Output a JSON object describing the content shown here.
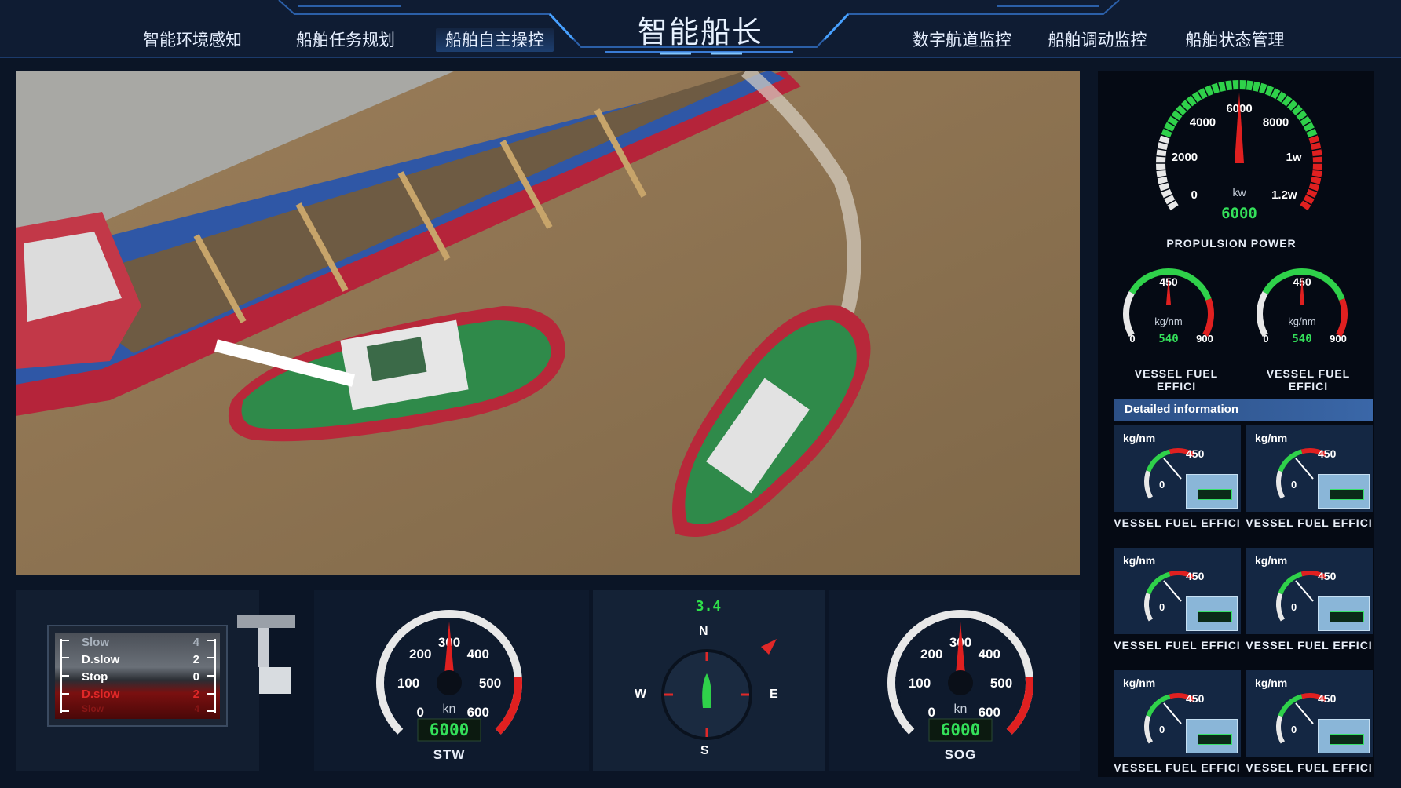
{
  "header": {
    "title": "智能船长",
    "nav_left": [
      "智能环境感知",
      "船舶任务规划",
      "船舶自主操控"
    ],
    "nav_right": [
      "数字航道监控",
      "船舶调动监控",
      "船舶状态管理"
    ],
    "active_nav": "船舶自主操控"
  },
  "propulsion": {
    "label": "PROPULSION POWER",
    "unit": "kw",
    "readout": "6000",
    "ticks": [
      "0",
      "2000",
      "4000",
      "6000",
      "8000",
      "1w",
      "1.2w"
    ]
  },
  "fuel_gauges": [
    {
      "label": "VESSEL FUEL EFFICI",
      "unit": "kg/nm",
      "max_label": "450",
      "min": "0",
      "max": "900",
      "readout": "540"
    },
    {
      "label": "VESSEL FUEL EFFICI",
      "unit": "kg/nm",
      "max_label": "450",
      "min": "0",
      "max": "900",
      "readout": "540"
    }
  ],
  "detail": {
    "header": "Detailed information",
    "cells": [
      {
        "unit": "kg/nm",
        "max": "450",
        "min": "0",
        "label": "VESSEL FUEL EFFICI"
      },
      {
        "unit": "kg/nm",
        "max": "450",
        "min": "0",
        "label": "VESSEL FUEL EFFICI"
      },
      {
        "unit": "kg/nm",
        "max": "450",
        "min": "0",
        "label": "VESSEL FUEL EFFICI"
      },
      {
        "unit": "kg/nm",
        "max": "450",
        "min": "0",
        "label": "VESSEL FUEL EFFICI"
      },
      {
        "unit": "kg/nm",
        "max": "450",
        "min": "0",
        "label": "VESSEL FUEL EFFICI"
      },
      {
        "unit": "kg/nm",
        "max": "450",
        "min": "0",
        "label": "VESSEL FUEL EFFICI"
      }
    ]
  },
  "telegraph": {
    "rows": [
      {
        "label": "Slow",
        "value": "4"
      },
      {
        "label": "D.slow",
        "value": "2"
      },
      {
        "label": "Stop",
        "value": "0"
      },
      {
        "label": "D.slow",
        "value": "2"
      },
      {
        "label": "Slow",
        "value": "4"
      }
    ]
  },
  "stw": {
    "label": "STW",
    "unit": "kn",
    "readout": "6000",
    "ticks": [
      "0",
      "100",
      "200",
      "300",
      "400",
      "500",
      "600"
    ]
  },
  "sog": {
    "label": "SOG",
    "unit": "kn",
    "readout": "6000",
    "ticks": [
      "0",
      "100",
      "200",
      "300",
      "400",
      "500",
      "600"
    ]
  },
  "compass": {
    "heading_readout": "3.4",
    "n": "N",
    "s": "S",
    "e": "E",
    "w": "W"
  },
  "colors": {
    "accent": "#1f5aa8",
    "green": "#2fd14a",
    "red": "#e02020",
    "lcd": "#34e05a"
  }
}
